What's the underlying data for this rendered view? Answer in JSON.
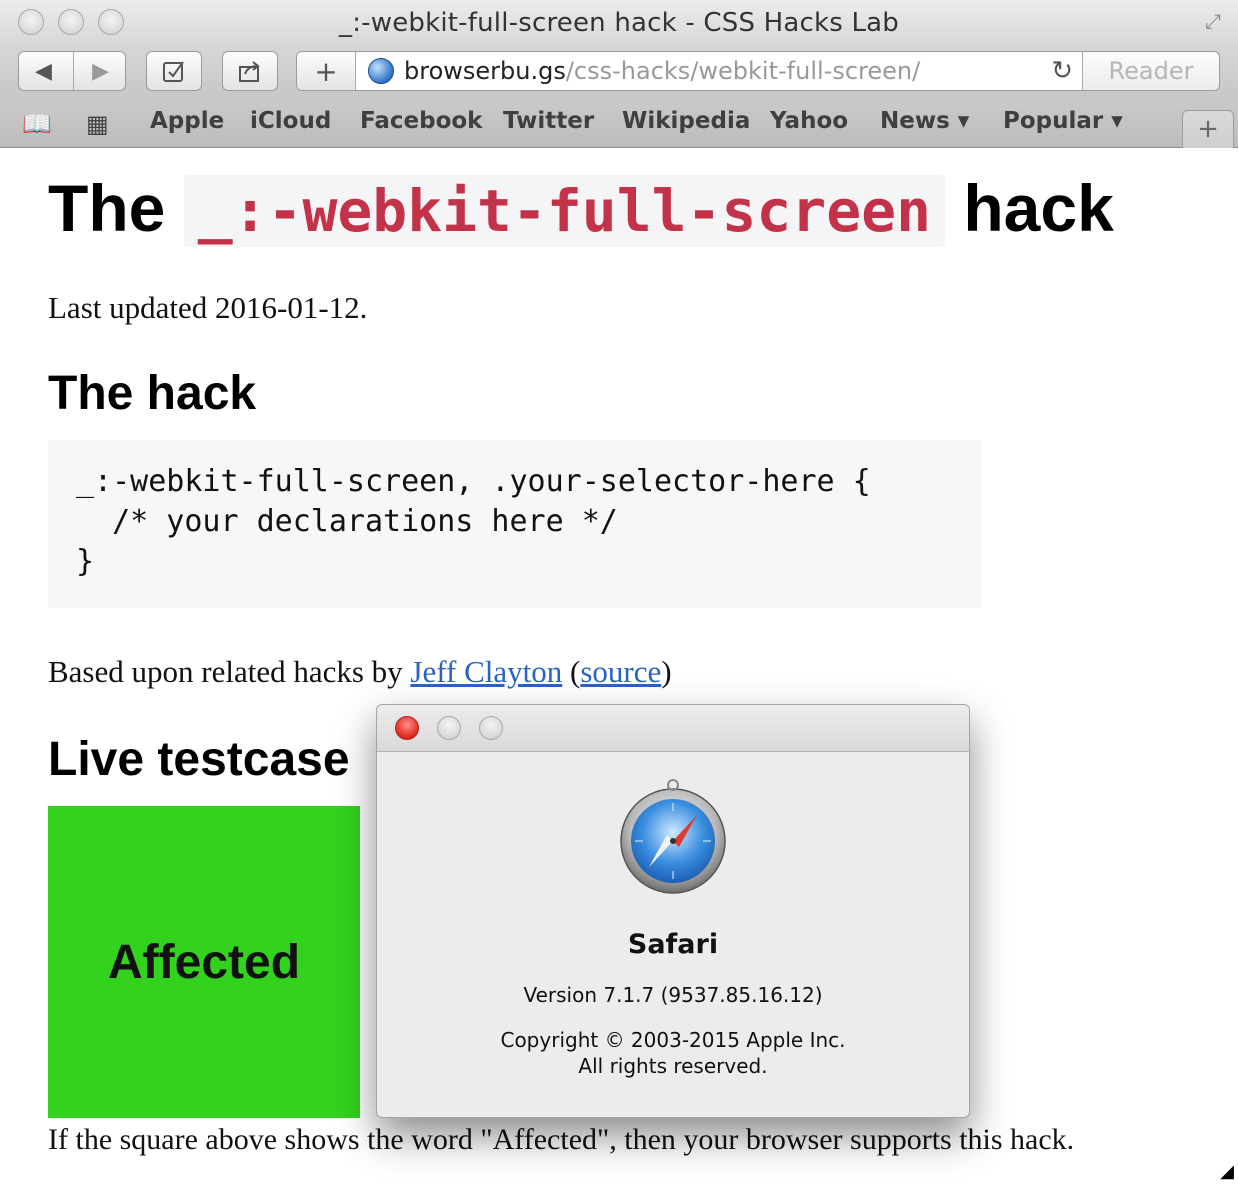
{
  "window": {
    "title": "_:-webkit-full-screen hack - CSS Hacks Lab"
  },
  "toolbar": {
    "back_icon": "back-arrow-icon",
    "forward_icon": "forward-arrow-icon",
    "url_host": "browserbu.gs",
    "url_path": "/css-hacks/webkit-full-screen/",
    "reader_label": "Reader"
  },
  "bookmarks": {
    "items": [
      "Apple",
      "iCloud",
      "Facebook",
      "Twitter",
      "Wikipedia",
      "Yahoo",
      "News ▾",
      "Popular ▾"
    ]
  },
  "page": {
    "title_prefix": "The",
    "title_code": "_:-webkit-full-screen",
    "title_suffix": "hack",
    "updated": "Last updated 2016-01-12.",
    "hack_heading": "The hack",
    "code": "_:-webkit-full-screen, .your-selector-here {\n  /* your declarations here */\n}",
    "based_prefix": "Based upon related hacks by",
    "based_author": "Jeff Clayton",
    "based_open": "(",
    "based_source": "source",
    "based_close": ")",
    "testcase_heading": "Live testcase",
    "testbox_label": "Affected",
    "footnote": "If the square above shows the word \"Affected\", then your browser supports this hack.",
    "testbox_color": "#32d21e"
  },
  "about_dialog": {
    "app_name": "Safari",
    "version": "Version 7.1.7 (9537.85.16.12)",
    "copyright_line1": "Copyright © 2003-2015 Apple Inc.",
    "copyright_line2": "All rights reserved."
  },
  "colors": {
    "code_accent": "#c2334a",
    "link": "#2a62c5"
  }
}
